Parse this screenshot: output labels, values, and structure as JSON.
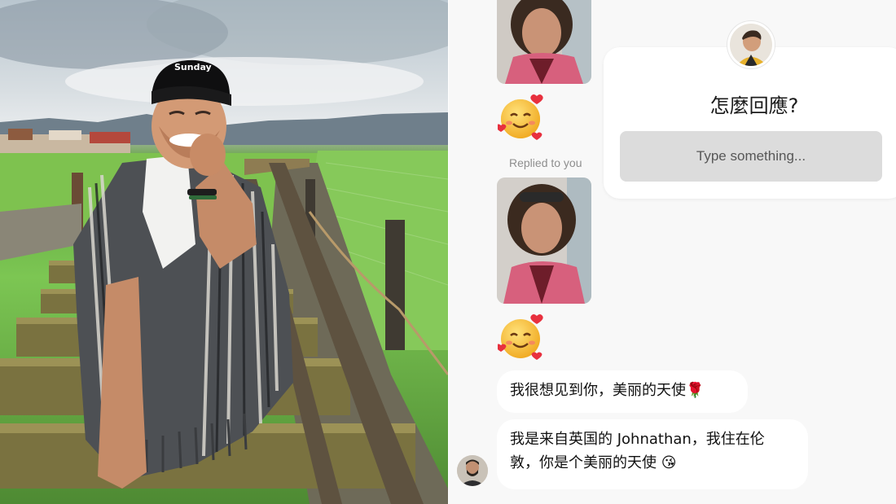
{
  "photo": {
    "subject": "man-sitting-on-rail-track",
    "cap_text": "Sunday"
  },
  "chat": {
    "replied_label": "Replied to you",
    "messages": [
      {
        "text": "我很想见到你，美丽的天使",
        "emoji": "🌹"
      },
      {
        "text_line1": "我是来自英国的 Johnathan，我住在伦",
        "text_line2": "敦，你是个美丽的天使",
        "emoji": "😘"
      }
    ],
    "reaction_emoji": "smiling-face-with-hearts-icon"
  },
  "sticker": {
    "question": "怎麼回應?",
    "placeholder": "Type something..."
  },
  "colors": {
    "chat_bg": "#f8f8f8",
    "bubble_bg": "#ffffff",
    "field_bg": "#dcdcdc",
    "muted_text": "#8e8e8e"
  }
}
